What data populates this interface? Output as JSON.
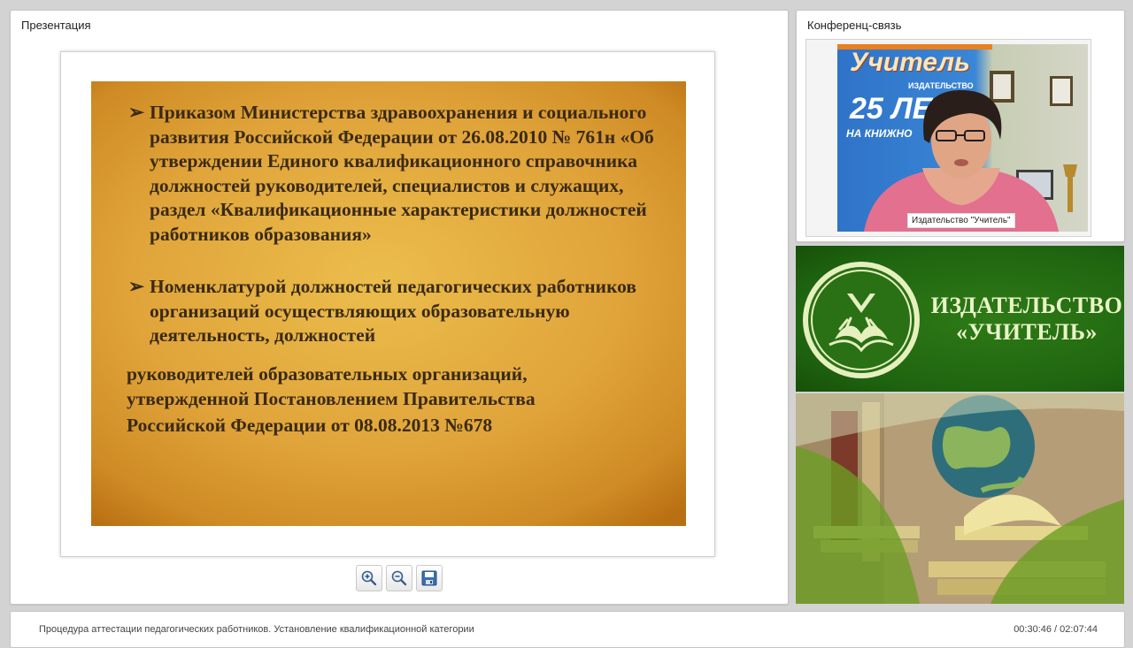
{
  "presentation": {
    "panel_title": "Презентация",
    "slide": {
      "bullet_marker": "➢",
      "bullet1": "Приказом Министерства здравоохранения и социального развития Российской Федерации от 26.08.2010 № 761н «Об утверждении Единого квалификационного справочника должностей руководителей, специалистов и служащих, раздел «Квалификационные характеристики должностей работников образования»",
      "bullet2": "Номенклатурой должностей педагогических работников  организаций осуществляющих образовательную деятельность, должностей",
      "continuation_line1": "руководителей образовательных    организаций,",
      "continuation_line2": "утвержденной Постановлением Правительства",
      "continuation_line3": "Российской Федерации от 08.08.2013 №678"
    },
    "toolbar": {
      "zoom_in_icon": "zoom-in-icon",
      "zoom_out_icon": "zoom-out-icon",
      "save_icon": "floppy-disk-icon"
    }
  },
  "conference": {
    "panel_title": "Конференц-связь",
    "video": {
      "speaker_label": "Издательство \"Учитель\"",
      "banner_title": "Учитель",
      "banner_subtitle": "ИЗДАТЕЛЬСТВО",
      "banner_years": "25 ЛЕ",
      "banner_line": "НА КНИЖНО"
    }
  },
  "publisher": {
    "name_line1": "ИЗДАТЕЛЬСТВО",
    "name_line2": "«УЧИТЕЛЬ»"
  },
  "status": {
    "lecture_title": "Процедура аттестации педагогических работников. Установление квалификационной категории",
    "timecode": "00:30:46 / 02:07:44"
  },
  "colors": {
    "slide_gold": "#e0a43a",
    "slide_text": "#3a2a17",
    "publisher_green": "#1f6510",
    "publisher_text": "#e9f3c8"
  }
}
